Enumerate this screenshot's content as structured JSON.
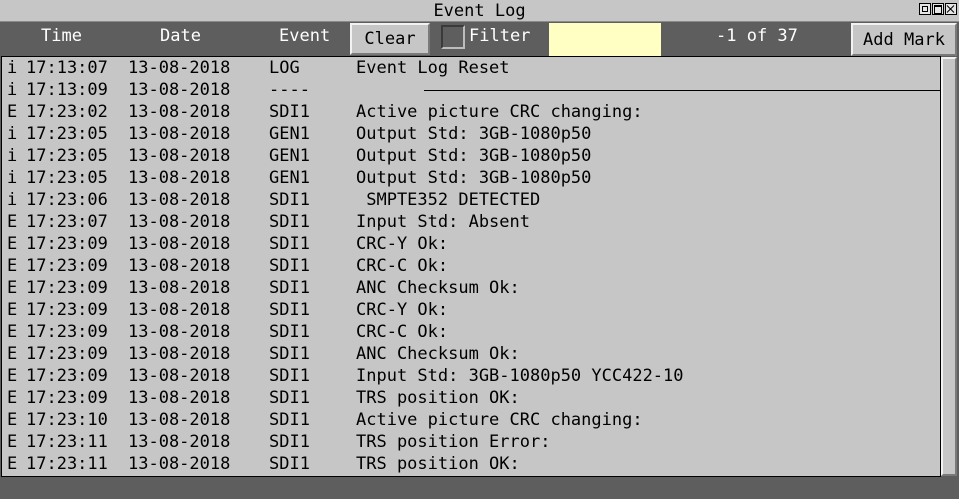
{
  "window": {
    "title": "Event Log"
  },
  "toolbar": {
    "col_time": "Time",
    "col_date": "Date",
    "col_event": "Event",
    "clear_label": "Clear",
    "filter_label": "Filter",
    "filter_value": "",
    "counter": "-1 of 37",
    "add_mark_label": "Add Mark"
  },
  "log": {
    "rows": [
      {
        "sev": "i",
        "time": "17:13:07",
        "date": "13-08-2018",
        "event": "LOG",
        "msg": "Event Log Reset"
      },
      {
        "sev": "i",
        "time": "17:13:09",
        "date": "13-08-2018",
        "event": "----",
        "msg": ""
      },
      {
        "sev": "E",
        "time": "17:23:02",
        "date": "13-08-2018",
        "event": "SDI1",
        "msg": "Active picture CRC changing:"
      },
      {
        "sev": "i",
        "time": "17:23:05",
        "date": "13-08-2018",
        "event": "GEN1",
        "msg": "Output Std: 3GB-1080p50"
      },
      {
        "sev": "i",
        "time": "17:23:05",
        "date": "13-08-2018",
        "event": "GEN1",
        "msg": "Output Std: 3GB-1080p50"
      },
      {
        "sev": "i",
        "time": "17:23:05",
        "date": "13-08-2018",
        "event": "GEN1",
        "msg": "Output Std: 3GB-1080p50"
      },
      {
        "sev": "i",
        "time": "17:23:06",
        "date": "13-08-2018",
        "event": "SDI1",
        "msg": " SMPTE352 DETECTED"
      },
      {
        "sev": "E",
        "time": "17:23:07",
        "date": "13-08-2018",
        "event": "SDI1",
        "msg": "Input Std: Absent"
      },
      {
        "sev": "E",
        "time": "17:23:09",
        "date": "13-08-2018",
        "event": "SDI1",
        "msg": "CRC-Y Ok:"
      },
      {
        "sev": "E",
        "time": "17:23:09",
        "date": "13-08-2018",
        "event": "SDI1",
        "msg": "CRC-C Ok:"
      },
      {
        "sev": "E",
        "time": "17:23:09",
        "date": "13-08-2018",
        "event": "SDI1",
        "msg": "ANC Checksum Ok:"
      },
      {
        "sev": "E",
        "time": "17:23:09",
        "date": "13-08-2018",
        "event": "SDI1",
        "msg": "CRC-Y Ok:"
      },
      {
        "sev": "E",
        "time": "17:23:09",
        "date": "13-08-2018",
        "event": "SDI1",
        "msg": "CRC-C Ok:"
      },
      {
        "sev": "E",
        "time": "17:23:09",
        "date": "13-08-2018",
        "event": "SDI1",
        "msg": "ANC Checksum Ok:"
      },
      {
        "sev": "E",
        "time": "17:23:09",
        "date": "13-08-2018",
        "event": "SDI1",
        "msg": "Input Std: 3GB-1080p50 YCC422-10"
      },
      {
        "sev": "E",
        "time": "17:23:09",
        "date": "13-08-2018",
        "event": "SDI1",
        "msg": "TRS position OK:"
      },
      {
        "sev": "E",
        "time": "17:23:10",
        "date": "13-08-2018",
        "event": "SDI1",
        "msg": "Active picture CRC changing:"
      },
      {
        "sev": "E",
        "time": "17:23:11",
        "date": "13-08-2018",
        "event": "SDI1",
        "msg": "TRS position Error:"
      },
      {
        "sev": "E",
        "time": "17:23:11",
        "date": "13-08-2018",
        "event": "SDI1",
        "msg": "TRS position OK:"
      }
    ]
  }
}
